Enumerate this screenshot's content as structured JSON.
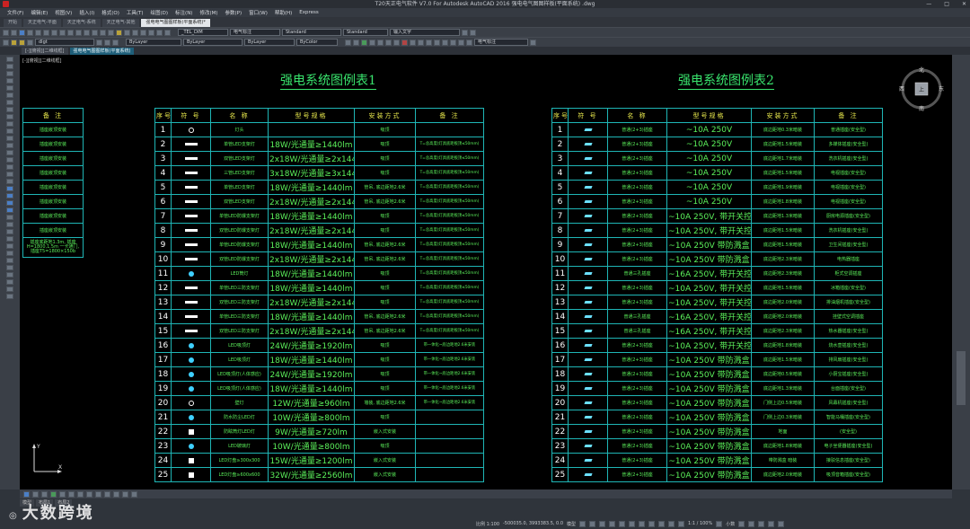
{
  "window": {
    "title": "T20天正电气软件 V7.0 For Autodesk AutoCAD 2016   强电电气图图样板(平面系统) .dwg",
    "controls": [
      "—",
      "□",
      "✕"
    ]
  },
  "menu": [
    "文件(F)",
    "编辑(E)",
    "视图(V)",
    "插入(I)",
    "格式(O)",
    "工具(T)",
    "绘图(D)",
    "标注(N)",
    "修改(M)",
    "参数(P)",
    "窗口(W)",
    "帮助(H)",
    "Express"
  ],
  "doctabs": [
    "开始",
    "天正电气-平面",
    "天正电气-系统",
    "天正电气-其他",
    "强电电气图图样板(平面系统)*"
  ],
  "toolbar1": {
    "standard_style": "Standard",
    "dim_style": "Standard",
    "text_style": "_TEL_DIM",
    "layer_name": "电气标注",
    "search_placeholder": "输入文字"
  },
  "toolbar2": {
    "layer": "dlgt",
    "color": "ByLayer",
    "linetype": "ByLayer",
    "lineweight": "ByLayer",
    "plot": "ByColor",
    "layer2": "电气标注"
  },
  "filetabs": [
    "[-][俯视][二维线框]",
    "强电电气图图样板(平面系统)"
  ],
  "canvas_hint": "[-][俯视][二维线框]",
  "titles": {
    "t1": "强电系统图例表1",
    "t2": "强电系统图例表2"
  },
  "compass": {
    "n": "北",
    "s": "南",
    "e": "东",
    "w": "西",
    "center": "上"
  },
  "ucs": {
    "x": "X",
    "y": "Y"
  },
  "left_table": {
    "header": "备 注",
    "rows": [
      "插座嵌顶安装",
      "插座嵌顶安装",
      "插座嵌顶安装",
      "插座嵌顶安装",
      "插座嵌顶安装",
      "插座嵌顶安装",
      "插座嵌顶安装",
      "插座嵌顶安装"
    ],
    "note": "插座底距地1.3m, 插座H=1800,1.5m   一卡通门,  插座T5=1800×150b"
  },
  "table1": {
    "headers": [
      "序号",
      "符 号",
      "名 称",
      "型号规格",
      "安装方式",
      "备 注"
    ],
    "rows": [
      {
        "n": "1",
        "sym": "circle",
        "name": "灯头",
        "spec": "",
        "mount": "吸顶",
        "note": ""
      },
      {
        "n": "2",
        "sym": "bar",
        "name": "单管LED支架灯",
        "spec": "18W/光通量≥1440lm",
        "mount": "吸顶",
        "note": "T=总高度(灯具底距板顶≤50mm)"
      },
      {
        "n": "3",
        "sym": "bar",
        "name": "双管LED支架灯",
        "spec": "2x18W/光通量≥2x1440lm",
        "mount": "吸顶",
        "note": "T=总高度(灯具底距板顶≤50mm)"
      },
      {
        "n": "4",
        "sym": "bar",
        "name": "三管LED支架灯",
        "spec": "3x18W/光通量≥3x1440lm",
        "mount": "吸顶",
        "note": "T=总高度(灯具底距板顶≤50mm)"
      },
      {
        "n": "5",
        "sym": "bar",
        "name": "单管LED支架灯",
        "spec": "18W/光通量≥1440lm",
        "mount": "管吊, 底边距地2.6米",
        "note": "T=总高度(灯具底距板顶≤50mm)"
      },
      {
        "n": "6",
        "sym": "bar",
        "name": "双管LED支架灯",
        "spec": "2x18W/光通量≥2x1440lm",
        "mount": "管吊, 底边距地2.6米",
        "note": "T=总高度(灯具底距板顶≤50mm)"
      },
      {
        "n": "7",
        "sym": "bar",
        "name": "单管LED防爆支架灯",
        "spec": "18W/光通量≥1440lm",
        "mount": "吸顶",
        "note": "T=总高度(灯具底距板顶≤50mm)"
      },
      {
        "n": "8",
        "sym": "bar",
        "name": "双管LED防爆支架灯",
        "spec": "2x18W/光通量≥2x1440lm",
        "mount": "吸顶",
        "note": "T=总高度(灯具底距板顶≤50mm)"
      },
      {
        "n": "9",
        "sym": "bar",
        "name": "单管LED防爆支架灯",
        "spec": "18W/光通量≥1440lm",
        "mount": "管吊, 底边距地2.6米",
        "note": "T=总高度(灯具底距板顶≤50mm)"
      },
      {
        "n": "10",
        "sym": "bar",
        "name": "双管LED防爆支架灯",
        "spec": "2x18W/光通量≥2x1440lm",
        "mount": "管吊, 底边距地2.6米",
        "note": "T=总高度(灯具底距板顶≤50mm)"
      },
      {
        "n": "11",
        "sym": "dot",
        "name": "LED筒灯",
        "spec": "18W/光通量≥1440lm",
        "mount": "吸顶",
        "note": "T=总高度(灯具底距板顶≤50mm)"
      },
      {
        "n": "12",
        "sym": "bar",
        "name": "单管LED三防支架灯",
        "spec": "18W/光通量≥1440lm",
        "mount": "吸顶",
        "note": "T=总高度(灯具底距板顶≤50mm)"
      },
      {
        "n": "13",
        "sym": "bar",
        "name": "双管LED三防支架灯",
        "spec": "2x18W/光通量≥2x1440lm",
        "mount": "吸顶",
        "note": "T=总高度(灯具底距板顶≤50mm)"
      },
      {
        "n": "14",
        "sym": "bar",
        "name": "单管LED三防支架灯",
        "spec": "18W/光通量≥1440lm",
        "mount": "管吊, 底边距地2.6米",
        "note": "T=总高度(灯具底距板顶≤50mm)"
      },
      {
        "n": "15",
        "sym": "bar",
        "name": "双管LED三防支架灯",
        "spec": "2x18W/光通量≥2x1440lm",
        "mount": "管吊, 底边距地2.6米",
        "note": "T=总高度(灯具底距板顶≤50mm)"
      },
      {
        "n": "16",
        "sym": "dot",
        "name": "LED吸顶灯",
        "spec": "24W/光通量≥1920lm",
        "mount": "吸顶",
        "note": "带一体化~底边距地2.6米安装"
      },
      {
        "n": "17",
        "sym": "dot",
        "name": "LED吸顶灯",
        "spec": "18W/光通量≥1440lm",
        "mount": "吸顶",
        "note": "带一体化~底边距地2.6米安装"
      },
      {
        "n": "18",
        "sym": "dot",
        "name": "LED吸顶灯(人体感应)",
        "spec": "24W/光通量≥1920lm",
        "mount": "吸顶",
        "note": "带一体化~底边距地2.6米安装"
      },
      {
        "n": "19",
        "sym": "dot",
        "name": "LED吸顶灯(人体感应)",
        "spec": "18W/光通量≥1440lm",
        "mount": "吸顶",
        "note": "带一体化~底边距地2.6米安装"
      },
      {
        "n": "20",
        "sym": "x",
        "name": "壁灯",
        "spec": "12W/光通量≥960lm",
        "mount": "墙装, 底边距地2.6米",
        "note": "带一体化~底边距地2.6米安装"
      },
      {
        "n": "21",
        "sym": "dot",
        "name": "防水防尘LED灯",
        "spec": "10W/光通量≥800lm",
        "mount": "吸顶",
        "note": ""
      },
      {
        "n": "22",
        "sym": "sq",
        "name": "防眩筒灯LED灯",
        "spec": "9W/光通量≥720lm",
        "mount": "嵌入式安装",
        "note": ""
      },
      {
        "n": "23",
        "sym": "dot",
        "name": "LED玻璃灯",
        "spec": "10W/光通量≥800lm",
        "mount": "吸顶",
        "note": ""
      },
      {
        "n": "24",
        "sym": "sq",
        "name": "LED灯盘≥300x300",
        "spec": "15W/光通量≥1200lm",
        "mount": "嵌入式安装",
        "note": ""
      },
      {
        "n": "25",
        "sym": "sq",
        "name": "LED灯盘≥600x600",
        "spec": "32W/光通量≥2560lm",
        "mount": "嵌入式安装",
        "note": ""
      }
    ]
  },
  "table2": {
    "headers": [
      "序号",
      "符 号",
      "名 称",
      "型号规格",
      "安装方式",
      "备 注"
    ],
    "rows": [
      {
        "n": "1",
        "name": "普通(2+3)插座",
        "spec": "~10A 250V",
        "mount": "底边距地0.3米暗装",
        "note": "普通插座(安全型)"
      },
      {
        "n": "2",
        "name": "普通(2+3)插座",
        "spec": "~10A 250V",
        "mount": "底边距地1.5米暗装",
        "note": "多媒体插座(安全型)"
      },
      {
        "n": "3",
        "name": "普通(2+3)插座",
        "spec": "~10A 250V",
        "mount": "底边距地1.7米暗装",
        "note": "洗衣机插座(安全型)"
      },
      {
        "n": "4",
        "name": "普通(2+3)插座",
        "spec": "~10A 250V",
        "mount": "底边距地1.5米暗装",
        "note": "电视插座(安全型)"
      },
      {
        "n": "5",
        "name": "普通(2+3)插座",
        "spec": "~10A 250V",
        "mount": "底边距地1.9米暗装",
        "note": "电视插座(安全型)"
      },
      {
        "n": "6",
        "name": "普通(2+3)插座",
        "spec": "~10A 250V",
        "mount": "底边距地1.8米暗装",
        "note": "电视插座(安全型)"
      },
      {
        "n": "7",
        "name": "普通(2+3)插座",
        "spec": "~10A 250V, 带开关控制, 带防溅盒",
        "mount": "底边距地1.3米暗装",
        "note": "厨房电源插座(安全型)"
      },
      {
        "n": "8",
        "name": "普通(2+3)插座",
        "spec": "~10A 250V, 带开关控制, 带防溅盒",
        "mount": "底边距地1.5米暗装",
        "note": "洗衣机插座(安全型)"
      },
      {
        "n": "9",
        "name": "普通(2+3)插座",
        "spec": "~10A 250V 带防溅盒",
        "mount": "底边距地1.5米暗装",
        "note": "卫生间插座(安全型)"
      },
      {
        "n": "10",
        "name": "普通(2+3)插座",
        "spec": "~10A 250V 带防溅盒",
        "mount": "底边距地2.3米暗装",
        "note": "电热器插座"
      },
      {
        "n": "11",
        "name": "普通三孔插座",
        "spec": "~16A 250V, 带开关控制",
        "mount": "底边距地2.3米暗装",
        "note": "柜式空调插座"
      },
      {
        "n": "12",
        "name": "普通(2+3)插座",
        "spec": "~10A 250V, 带开关控制",
        "mount": "底边距地1.5米暗装",
        "note": "冰箱插座(安全型)"
      },
      {
        "n": "13",
        "name": "普通(2+3)插座",
        "spec": "~10A 250V, 带开关控制",
        "mount": "底边距地2.0米暗装",
        "note": "排油烟机插座(安全型)"
      },
      {
        "n": "14",
        "name": "普通三孔插座",
        "spec": "~16A 250V, 带开关控制",
        "mount": "底边距地2.0米暗装",
        "note": "挂壁式空调插座"
      },
      {
        "n": "15",
        "name": "普通三孔插座",
        "spec": "~16A 250V, 带开关控制, 带防溅盒",
        "mount": "底边距地2.3米暗装",
        "note": "热水器插座(安全型)"
      },
      {
        "n": "16",
        "name": "普通(2+3)插座",
        "spec": "~10A 250V, 带开关控制",
        "mount": "底边距地1.8米暗装",
        "note": "烧水壶插座(安全型)"
      },
      {
        "n": "17",
        "name": "普通(2+3)插座",
        "spec": "~10A 250V 带防溅盒",
        "mount": "底边距地1.5米暗装",
        "note": "排风扇插座(安全型)"
      },
      {
        "n": "18",
        "name": "普通(2+3)插座",
        "spec": "~10A 250V 带防溅盒",
        "mount": "底边距地0.5米暗装",
        "note": "小厨宝插座(安全型)"
      },
      {
        "n": "19",
        "name": "普通(2+3)插座",
        "spec": "~10A 250V 带防溅盒",
        "mount": "底边距地1.3米暗装",
        "note": "台面插座(安全型)"
      },
      {
        "n": "20",
        "name": "普通(2+3)插座",
        "spec": "~10A 250V 带防溅盒",
        "mount": "门侧上边0.5米暗装",
        "note": "风幕机插座(安全型)"
      },
      {
        "n": "21",
        "name": "普通(2+3)插座",
        "spec": "~10A 250V 带防溅盒",
        "mount": "门侧上边0.3米暗装",
        "note": "智能马桶插座(安全型)"
      },
      {
        "n": "22",
        "name": "普通(2+3)插座",
        "spec": "~10A 250V 带防溅盒",
        "mount": "地面",
        "note": "(安全型)"
      },
      {
        "n": "23",
        "name": "普通(2+3)插座",
        "spec": "~10A 250V 带防溅盒",
        "mount": "底边距地1.8米暗装",
        "note": "电子坐便器插座(安全型)"
      },
      {
        "n": "24",
        "name": "普通(2+3)插座",
        "spec": "~10A 250V 带防溅盒",
        "mount": "带防溅盒 暗装",
        "note": "接驳信息插座(安全型)"
      },
      {
        "n": "25",
        "name": "普通(2+3)插座",
        "spec": "~10A 250V 带防溅盒",
        "mount": "底边距地2.0米暗装",
        "note": "吸顶音箱插座(安全型)"
      }
    ]
  },
  "layouttabs": [
    "模型",
    "布局1",
    "布局2"
  ],
  "status": {
    "scale": "比例 1:100",
    "coords": "-500035.0, 3993383.5, 0.0",
    "model": "模型",
    "zoom": "1:1 / 100%",
    "mode": "小数"
  },
  "watermark": "大数跨境"
}
